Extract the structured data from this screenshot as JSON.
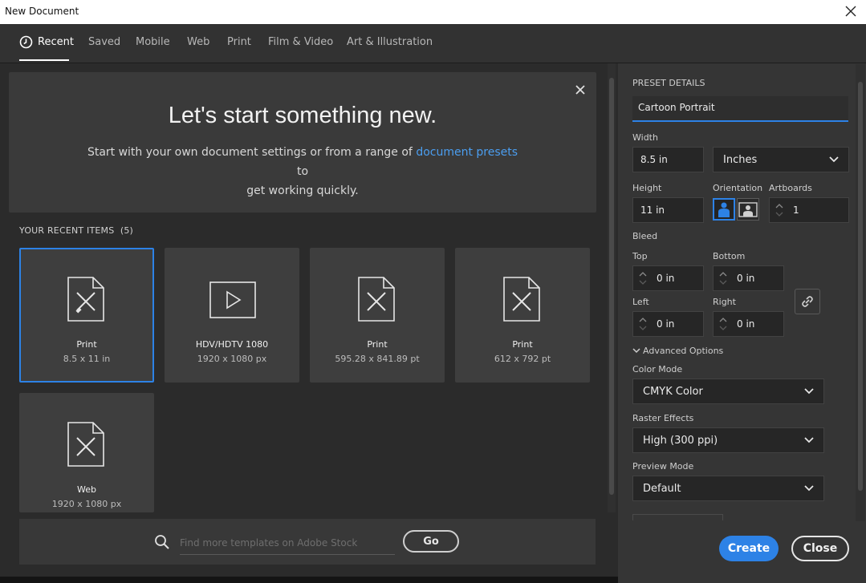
{
  "window": {
    "title": "New Document"
  },
  "tabs": [
    {
      "label": "Recent",
      "active": true
    },
    {
      "label": "Saved"
    },
    {
      "label": "Mobile"
    },
    {
      "label": "Web"
    },
    {
      "label": "Print"
    },
    {
      "label": "Film & Video"
    },
    {
      "label": "Art & Illustration"
    }
  ],
  "hero": {
    "heading": "Let's start something new.",
    "line1_a": "Start with your own document settings or from a range of ",
    "line1_link": "document presets",
    "line1_b": " to",
    "line2": "get working quickly."
  },
  "recent": {
    "label": "YOUR RECENT ITEMS",
    "count": "(5)",
    "items": [
      {
        "name": "Print",
        "size": "8.5 x 11 in",
        "icon": "document-pen-icon",
        "selected": true
      },
      {
        "name": "HDV/HDTV 1080",
        "size": "1920 x 1080 px",
        "icon": "video-play-icon"
      },
      {
        "name": "Print",
        "size": "595.28 x 841.89 pt",
        "icon": "document-pen-icon"
      },
      {
        "name": "Print",
        "size": "612 x 792 pt",
        "icon": "document-pen-icon"
      },
      {
        "name": "Web",
        "size": "1920 x 1080 px",
        "icon": "document-pen-icon"
      }
    ]
  },
  "search": {
    "placeholder": "Find more templates on Adobe Stock",
    "go_label": "Go"
  },
  "preset": {
    "section_label": "PRESET DETAILS",
    "name": "Cartoon Portrait",
    "width_label": "Width",
    "width_value": "8.5 in",
    "units": "Inches",
    "height_label": "Height",
    "height_value": "11 in",
    "orientation_label": "Orientation",
    "artboards_label": "Artboards",
    "artboards_value": "1",
    "bleed_label": "Bleed",
    "top_label": "Top",
    "top_value": "0 in",
    "bottom_label": "Bottom",
    "bottom_value": "0 in",
    "left_label": "Left",
    "left_value": "0 in",
    "right_label": "Right",
    "right_value": "0 in",
    "advanced_label": "Advanced Options",
    "color_mode_label": "Color Mode",
    "color_mode_value": "CMYK Color",
    "raster_label": "Raster Effects",
    "raster_value": "High (300 ppi)",
    "preview_label": "Preview Mode",
    "preview_value": "Default"
  },
  "buttons": {
    "create": "Create",
    "close": "Close"
  },
  "colors": {
    "accent": "#2d82e6",
    "panel": "#353535",
    "background": "#2b2b2b"
  }
}
